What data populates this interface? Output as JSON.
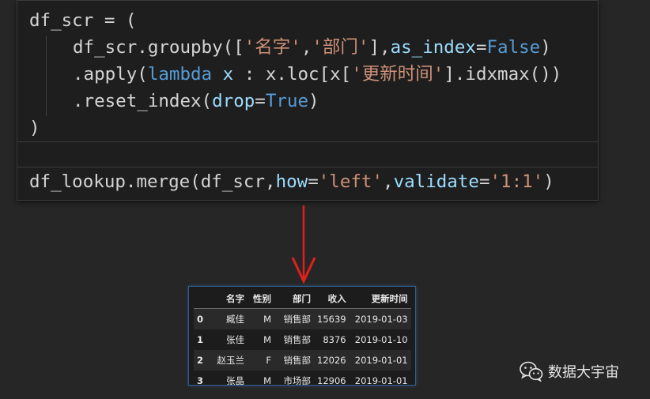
{
  "code": {
    "line1": "df_scr = (",
    "line2": {
      "p1": "df_scr.groupby([",
      "s1": "'名字'",
      "p2": ",",
      "s2": "'部门'",
      "p3": "],",
      "k1": "as_index",
      "p4": "=",
      "k2": "False",
      "p5": ")"
    },
    "line3": {
      "p1": ".apply(",
      "k1": "lambda",
      "p2": " ",
      "k2": "x",
      "p3": " : x.loc[x[",
      "s1": "'更新时间'",
      "p4": "].idxmax())"
    },
    "line4": {
      "p1": ".reset_index(",
      "k1": "drop",
      "p2": "=",
      "k2": "True",
      "p3": ")"
    },
    "line5": ")",
    "line6": {
      "p1": "df_lookup.merge(df_scr,",
      "k1": "how",
      "p2": "=",
      "s1": "'left'",
      "p3": ",",
      "k2": "validate",
      "p4": "=",
      "s2": "'1:1'",
      "p5": ")"
    }
  },
  "table": {
    "columns": [
      "",
      "名字",
      "性别",
      "部门",
      "收入",
      "更新时间"
    ],
    "rows": [
      [
        "0",
        "臧佳",
        "M",
        "销售部",
        "15639",
        "2019-01-03"
      ],
      [
        "1",
        "张佳",
        "M",
        "销售部",
        "8376",
        "2019-01-10"
      ],
      [
        "2",
        "赵玉兰",
        "F",
        "销售部",
        "12026",
        "2019-01-01"
      ],
      [
        "3",
        "张晶",
        "M",
        "市场部",
        "12906",
        "2019-01-01"
      ]
    ]
  },
  "watermark": {
    "text": "数据大宇宙",
    "icon": "wechat-icon"
  },
  "colors": {
    "background": "#262626",
    "editor": "#1e1e1e",
    "string": "#ce9178",
    "keyword": "#569cd6",
    "param": "#9cdcfe",
    "arrow": "#e0201c"
  }
}
